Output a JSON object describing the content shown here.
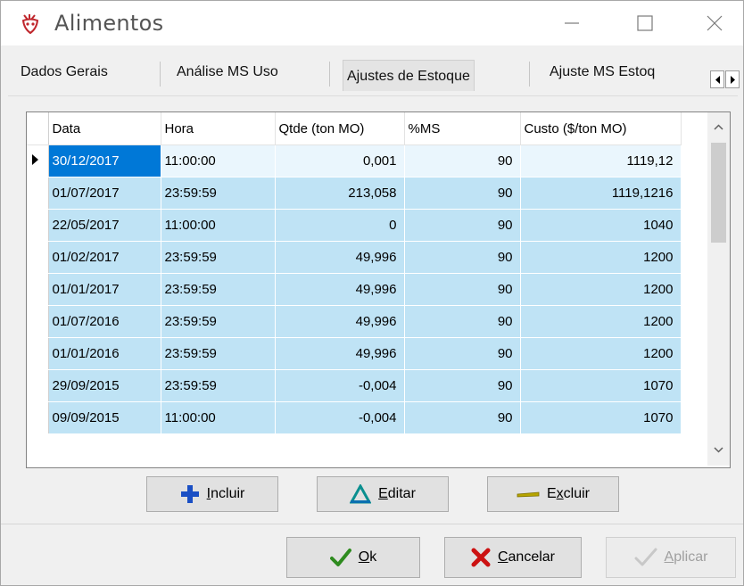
{
  "window": {
    "title": "Alimentos",
    "controls": {
      "minimize": "minimize-icon",
      "maximize": "maximize-icon",
      "close": "close-icon"
    }
  },
  "tabs": [
    {
      "label": "Dados Gerais",
      "active": false
    },
    {
      "label": "Análise MS Uso",
      "active": false
    },
    {
      "label": "Ajustes de Estoque",
      "active": true
    },
    {
      "label": "Ajuste MS Estoq",
      "active": false
    }
  ],
  "grid": {
    "columns": [
      "Data",
      "Hora",
      "Qtde (ton MO)",
      "%MS",
      "Custo ($/ton MO)"
    ],
    "rows": [
      {
        "data": "30/12/2017",
        "hora": "11:00:00",
        "qtde": "0,001",
        "ms": "90",
        "custo": "1119,12"
      },
      {
        "data": "01/07/2017",
        "hora": "23:59:59",
        "qtde": "213,058",
        "ms": "90",
        "custo": "1119,1216"
      },
      {
        "data": "22/05/2017",
        "hora": "11:00:00",
        "qtde": "0",
        "ms": "90",
        "custo": "1040"
      },
      {
        "data": "01/02/2017",
        "hora": "23:59:59",
        "qtde": "49,996",
        "ms": "90",
        "custo": "1200"
      },
      {
        "data": "01/01/2017",
        "hora": "23:59:59",
        "qtde": "49,996",
        "ms": "90",
        "custo": "1200"
      },
      {
        "data": "01/07/2016",
        "hora": "23:59:59",
        "qtde": "49,996",
        "ms": "90",
        "custo": "1200"
      },
      {
        "data": "01/01/2016",
        "hora": "23:59:59",
        "qtde": "49,996",
        "ms": "90",
        "custo": "1200"
      },
      {
        "data": "29/09/2015",
        "hora": "23:59:59",
        "qtde": "-0,004",
        "ms": "90",
        "custo": "1070"
      },
      {
        "data": "09/09/2015",
        "hora": "11:00:00",
        "qtde": "-0,004",
        "ms": "90",
        "custo": "1070"
      }
    ],
    "current_row_marker": "row-pointer-icon"
  },
  "actions": {
    "incluir": {
      "mnemonic": "I",
      "rest": "ncluir"
    },
    "editar": {
      "mnemonic": "E",
      "rest": "ditar"
    },
    "excluir": {
      "before": "E",
      "mnemonic": "x",
      "rest": "cluir"
    }
  },
  "footer": {
    "ok": {
      "mnemonic": "O",
      "rest": "k"
    },
    "cancelar": {
      "mnemonic": "C",
      "rest": "ancelar"
    },
    "aplicar": {
      "mnemonic": "A",
      "rest": "plicar",
      "enabled": false
    }
  },
  "colors": {
    "row_bg": "#bfe3f5",
    "selection": "#0078d7",
    "add_icon": "#1a4fc4",
    "edit_icon": "#0a8f8f",
    "delete_icon": "#b6a400",
    "ok_icon": "#2e8b1f",
    "cancel_icon": "#cc1111"
  }
}
